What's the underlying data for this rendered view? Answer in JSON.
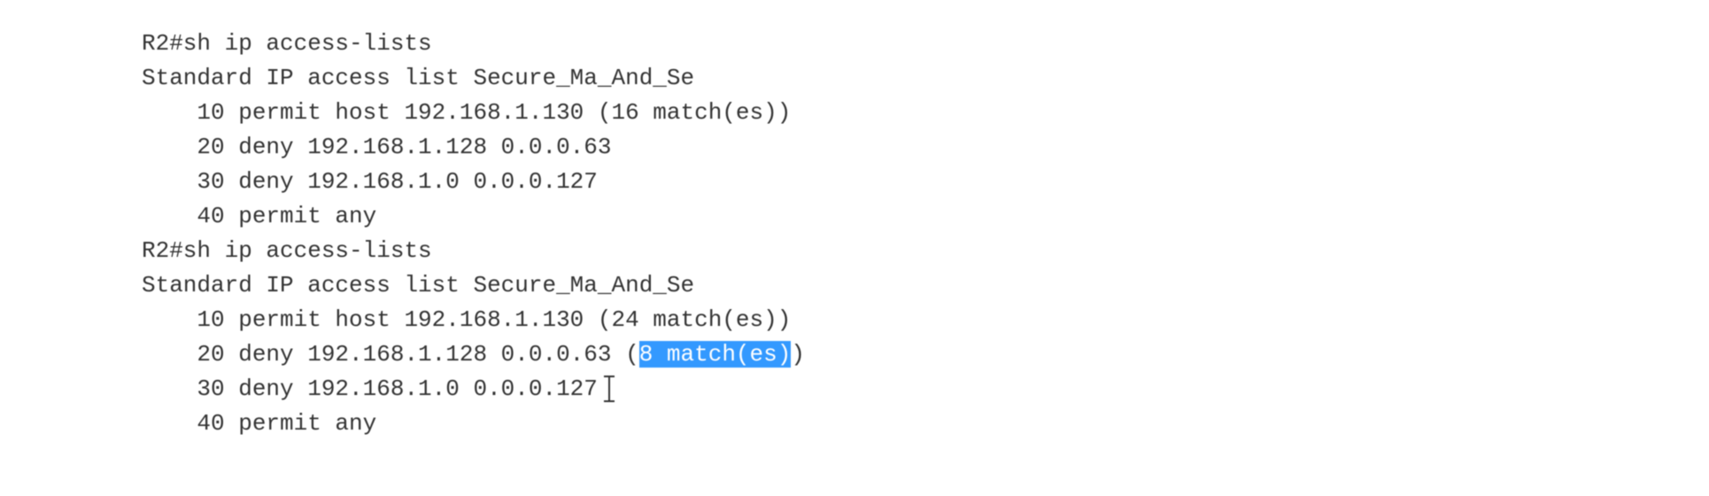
{
  "terminal": {
    "lines": [
      {
        "indent": 0,
        "text": "R2#sh ip access-lists"
      },
      {
        "indent": 0,
        "text": "Standard IP access list Secure_Ma_And_Se"
      },
      {
        "indent": 1,
        "text": "10 permit host 192.168.1.130 (16 match(es))"
      },
      {
        "indent": 1,
        "text": "20 deny 192.168.1.128 0.0.0.63"
      },
      {
        "indent": 1,
        "text": "30 deny 192.168.1.0 0.0.0.127"
      },
      {
        "indent": 1,
        "text": "40 permit any"
      },
      {
        "indent": 0,
        "text": "R2#sh ip access-lists"
      },
      {
        "indent": 0,
        "text": "Standard IP access list Secure_Ma_And_Se"
      },
      {
        "indent": 1,
        "text": "10 permit host 192.168.1.130 (24 match(es))"
      },
      {
        "indent": 1,
        "pre": "20 deny 192.168.1.128 0.0.0.63 (",
        "sel": "8 match(es)",
        "post": ")"
      },
      {
        "indent": 1,
        "text": "30 deny 192.168.1.0 0.0.0.127",
        "cursor": true
      },
      {
        "indent": 1,
        "text": "40 permit any"
      }
    ],
    "indent_unit": "    "
  }
}
